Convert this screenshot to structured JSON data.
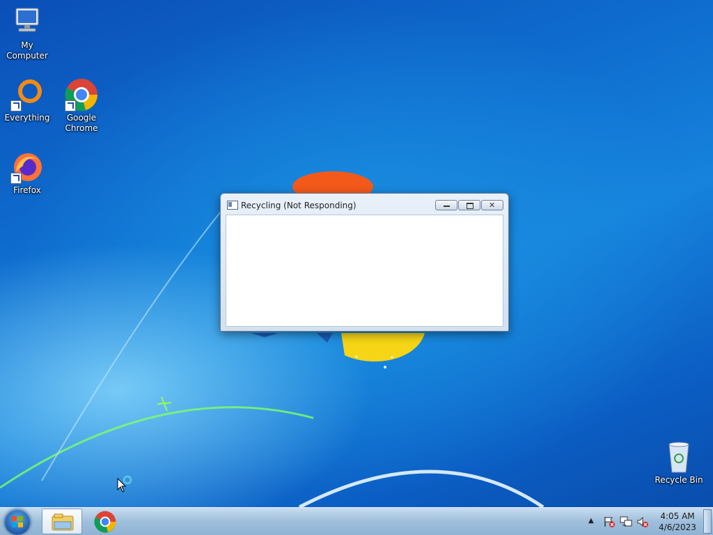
{
  "desktop": {
    "icons": [
      {
        "label": "My Computer",
        "icon": "computer-icon"
      },
      {
        "label": "Everything",
        "icon": "everything-icon"
      },
      {
        "label": "Google Chrome",
        "icon": "chrome-icon"
      },
      {
        "label": "Firefox",
        "icon": "firefox-icon"
      },
      {
        "label": "Recycle Bin",
        "icon": "recycle-bin-icon"
      }
    ]
  },
  "window": {
    "title": "Recycling  (Not Responding)",
    "buttons": {
      "minimize": "minimize",
      "maximize": "maximize",
      "close": "close"
    }
  },
  "taskbar": {
    "start": "start-button",
    "pinned": [
      {
        "name": "Windows Explorer",
        "icon": "explorer-icon",
        "active": true
      },
      {
        "name": "Google Chrome",
        "icon": "chrome-icon",
        "active": false
      }
    ],
    "tray": {
      "icons": [
        "show-hidden-icons",
        "action-center-icon",
        "network-icon",
        "volume-muted-icon"
      ],
      "time": "4:05 AM",
      "date": "4/6/2023"
    }
  },
  "colors": {
    "desktop_blue": "#0f6fd0",
    "taskbar": "#a9c6e2",
    "window_frame": "#d3e1ef"
  }
}
